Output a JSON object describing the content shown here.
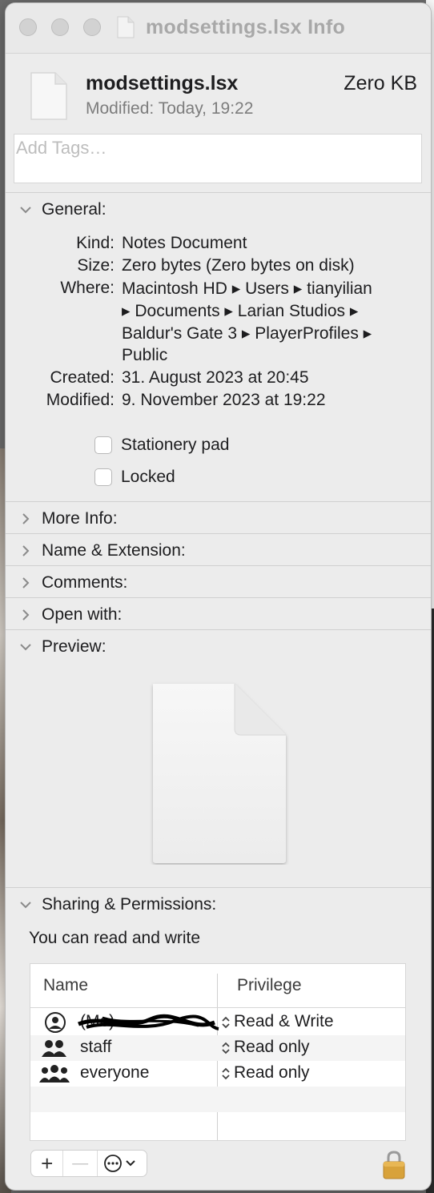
{
  "window": {
    "title": "modsettings.lsx Info"
  },
  "file": {
    "name": "modsettings.lsx",
    "size_label": "Zero KB",
    "modified_label": "Modified:",
    "modified_value": "Today, 19:22"
  },
  "tags": {
    "placeholder": "Add Tags…"
  },
  "general": {
    "header": "General:",
    "expanded": true,
    "rows": [
      {
        "label": "Kind:",
        "value": "Notes Document"
      },
      {
        "label": "Size:",
        "value": "Zero bytes (Zero bytes on disk)"
      },
      {
        "label": "Where:",
        "value_lines": [
          "Macintosh HD ▸ Users ▸ tianyilian",
          "▸ Documents ▸ Larian Studios ▸",
          "Baldur's Gate 3 ▸ PlayerProfiles ▸",
          "Public"
        ]
      },
      {
        "label": "Created:",
        "value": "31. August 2023 at 20:45"
      },
      {
        "label": "Modified:",
        "value": "9. November 2023 at 19:22"
      }
    ],
    "checkboxes": [
      {
        "label": "Stationery pad",
        "checked": false
      },
      {
        "label": "Locked",
        "checked": false
      }
    ]
  },
  "sections": [
    {
      "label": "More Info:",
      "expanded": false
    },
    {
      "label": "Name & Extension:",
      "expanded": false
    },
    {
      "label": "Comments:",
      "expanded": false
    },
    {
      "label": "Open with:",
      "expanded": false
    },
    {
      "label": "Preview:",
      "expanded": true
    }
  ],
  "sharing": {
    "header": "Sharing & Permissions:",
    "expanded": true,
    "caption": "You can read and write",
    "columns": {
      "name": "Name",
      "privilege": "Privilege"
    },
    "rows": [
      {
        "name": "(Me)",
        "privilege": "Read & Write",
        "icon": "user-icon",
        "redacted": true
      },
      {
        "name": "staff",
        "privilege": "Read only",
        "icon": "group-icon"
      },
      {
        "name": "everyone",
        "privilege": "Read only",
        "icon": "everyone-icon"
      }
    ]
  },
  "toolbar": {
    "add": "+",
    "remove": "—",
    "action_icon": "ellipsis-icon"
  },
  "colors": {
    "window_bg": "#ececec",
    "title_text": "#a8a8a8",
    "secondary_text": "#7d7d7d",
    "lock_gold": "#d8a23a"
  }
}
